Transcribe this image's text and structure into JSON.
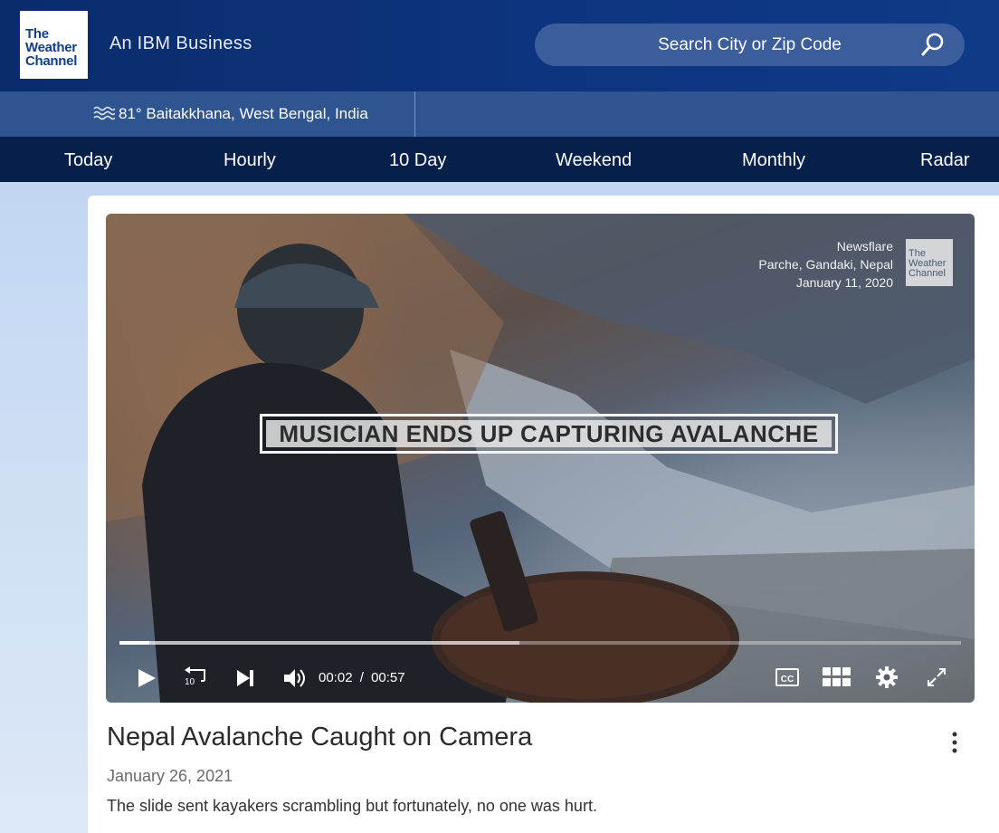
{
  "brand": {
    "logo_lines": [
      "The",
      "Weather",
      "Channel"
    ],
    "tagline_prefix": "An",
    "tagline_brand": "IBM Business"
  },
  "search": {
    "placeholder": "Search City or Zip Code",
    "icon": "search-icon"
  },
  "location": {
    "icon": "wave-icon",
    "text": "81° Baitakkhana, West Bengal, India"
  },
  "nav": {
    "items": [
      {
        "label": "Today"
      },
      {
        "label": "Hourly"
      },
      {
        "label": "10 Day"
      },
      {
        "label": "Weekend"
      },
      {
        "label": "Monthly"
      },
      {
        "label": "Radar"
      }
    ]
  },
  "video": {
    "watermark": {
      "source": "Newsflare",
      "place": "Parche, Gandaki, Nepal",
      "date": "January 11, 2020",
      "logo_lines": [
        "The",
        "Weather",
        "Channel"
      ]
    },
    "headline": "MUSICIAN ENDS UP CAPTURING AVALANCHE",
    "current_time": "00:02",
    "separator": "/",
    "duration": "00:57",
    "played_fraction": 0.035,
    "buffered_fraction": 0.475,
    "controls": {
      "play": "play-icon",
      "rewind": "rewind-10-icon",
      "rewind_label": "10",
      "next": "skip-next-icon",
      "volume": "volume-icon",
      "captions": "cc-icon",
      "captions_label": "CC",
      "playlist": "grid-icon",
      "settings": "gear-icon",
      "fullscreen": "fullscreen-icon"
    }
  },
  "article": {
    "title": "Nepal Avalanche Caught on Camera",
    "date": "January 26, 2021",
    "description": "The slide sent kayakers scrambling but fortunately, no one was hurt."
  },
  "colors": {
    "header_bg": "#0d3580",
    "location_bg": "#2f5590",
    "nav_bg": "#05204b",
    "search_bg": "#3b5d9c"
  }
}
